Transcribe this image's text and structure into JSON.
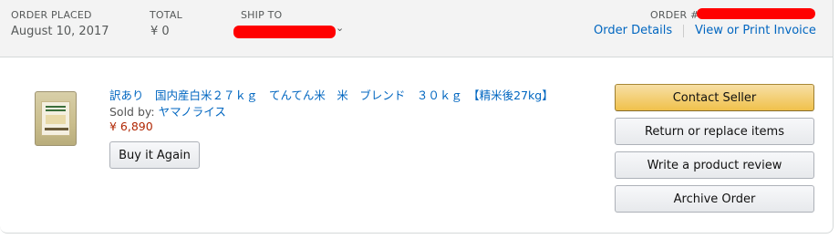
{
  "header": {
    "order_placed_label": "ORDER PLACED",
    "order_placed_value": "August 10, 2017",
    "total_label": "TOTAL",
    "total_value": "¥ 0",
    "ship_to_label": "SHIP TO",
    "order_label": "ORDER #",
    "order_details_link": "Order Details",
    "invoice_link": "View or Print Invoice"
  },
  "item": {
    "title": "訳あり　国内産白米２７ｋｇ　てんてん米　米　ブレンド　３０ｋｇ　【精米後27kg】",
    "sold_by_label": "Sold by: ",
    "seller": "ヤマノライス",
    "price": "¥ 6,890",
    "buy_again_label": "Buy it Again"
  },
  "actions": {
    "contact_seller": "Contact Seller",
    "return_replace": "Return or replace items",
    "write_review": "Write a product review",
    "archive_order": "Archive Order"
  },
  "icons": {
    "ship_to_dropdown": "chevron-down-icon"
  },
  "colors": {
    "link": "#0066c0",
    "price": "#b12704",
    "primary_button": "#f0c14b",
    "header_bg": "#f3f3f3",
    "redaction": "#ff0000"
  }
}
